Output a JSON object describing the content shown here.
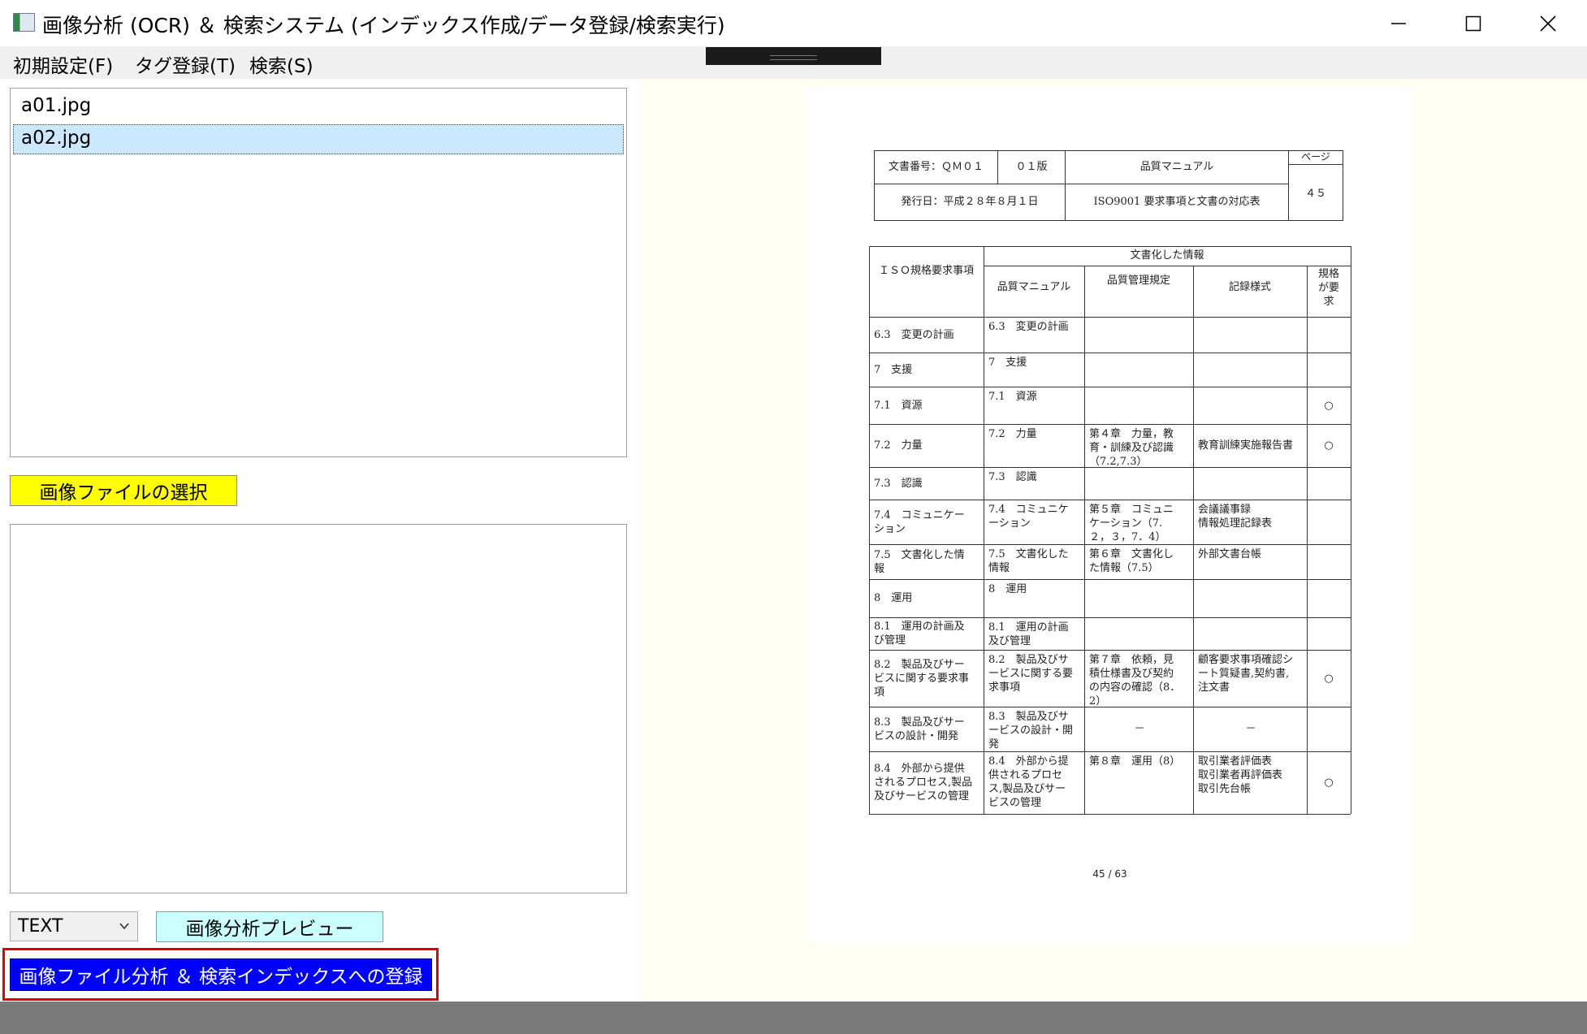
{
  "window": {
    "title": "画像分析 (OCR) ＆ 検索システム (インデックス作成/データ登録/検索実行)",
    "minimize_glyph": "—",
    "close_glyph": "✕"
  },
  "menu": [
    {
      "label": "初期設定(F)"
    },
    {
      "label": "タグ登録(T)"
    },
    {
      "label": "検索(S)"
    }
  ],
  "files": [
    "a01.jpg",
    "a02.jpg"
  ],
  "buttons": {
    "select_image": "画像ファイルの選択",
    "preview": "画像分析プレビュー",
    "register": "画像ファイル分析 ＆ 検索インデックスへの登録"
  },
  "mode_select": {
    "value": "TEXT"
  },
  "colors": {
    "select_button": "#ffff00",
    "preview_button": "#ccffff",
    "register_button": "#0000ff",
    "highlight_frame": "#e00000",
    "preview_background": "#fffef0"
  },
  "document": {
    "header": {
      "doc_number": "文書番号：ＱＭ０１",
      "edition": "０１版",
      "doc_title": "品質マニュアル",
      "page_label": "ページ",
      "issue_date": "発行日：平成２８年８月１日",
      "subject": "ISO9001 要求事項と文書の対応表",
      "page_number": "４５"
    },
    "table": {
      "col_iso": "ＩＳＯ規格要求事項",
      "group_header": "文書化した情報",
      "col_manual": "品質マニュアル",
      "col_rules": "品質管理規定",
      "col_forms": "記録様式",
      "col_required": "規格\nが要\n求",
      "rows": [
        {
          "iso": "6.3　変更の計画",
          "manual": "6.3　変更の計画",
          "rules": "",
          "forms": "",
          "req": ""
        },
        {
          "iso": "7　支援",
          "manual": "7　支援",
          "rules": "",
          "forms": "",
          "req": ""
        },
        {
          "iso": "7.1　資源",
          "manual": "7.1　資源",
          "rules": "",
          "forms": "",
          "req": "○"
        },
        {
          "iso": "7.2　力量",
          "manual": "7.2　力量",
          "rules": "第４章　力量，教\n育・訓練及び認識\n（7.2,7.3）",
          "forms": "教育訓練実施報告書",
          "req": "○"
        },
        {
          "iso": "7.3　認識",
          "manual": "7.3　認識",
          "rules": "",
          "forms": "",
          "req": ""
        },
        {
          "iso": "7.4　コミュニケー\nション",
          "manual": "7.4　コミュニケ\nーション",
          "rules": "第５章　コミュニ\nケーション（7.\n２，３，7．4）",
          "forms": "会議議事録\n情報処理記録表",
          "req": ""
        },
        {
          "iso": "7.5　文書化した情\n報",
          "manual": "7.5　文書化した\n情報",
          "rules": "第６章　文書化し\nた情報（7.5）",
          "forms": "外部文書台帳",
          "req": ""
        },
        {
          "iso": "8　運用",
          "manual": "8　運用",
          "rules": "",
          "forms": "",
          "req": ""
        },
        {
          "iso": "8.1　運用の計画及\nび管理",
          "manual": "8.1　運用の計画\n及び管理",
          "rules": "",
          "forms": "",
          "req": ""
        },
        {
          "iso": "8.2　製品及びサー\nビスに関する要求事\n項",
          "manual": "8.2　製品及びサ\nービスに関する要\n求事項",
          "rules": "第７章　依頼，見\n積仕様書及び契約\nの内容の確認（8．\n2）",
          "forms": "顧客要求事項確認シ\nート質疑書,契約書,\n注文書",
          "req": "○"
        },
        {
          "iso": "8.3　製品及びサー\nビスの設計・開発",
          "manual": "8.3　製品及びサ\nービスの設計・開\n発",
          "rules": "－",
          "forms": "－",
          "req": ""
        },
        {
          "iso": "8.4　外部から提供\nされるプロセス,製品\n及びサービスの管理",
          "manual": "8.4　外部から提\n供されるプロセ\nス,製品及びサー\nビスの管理",
          "rules": "第８章　運用（8）",
          "forms": "取引業者評価表\n取引業者再評価表\n取引先台帳",
          "req": "○"
        }
      ]
    },
    "footer": "45 / 63"
  }
}
